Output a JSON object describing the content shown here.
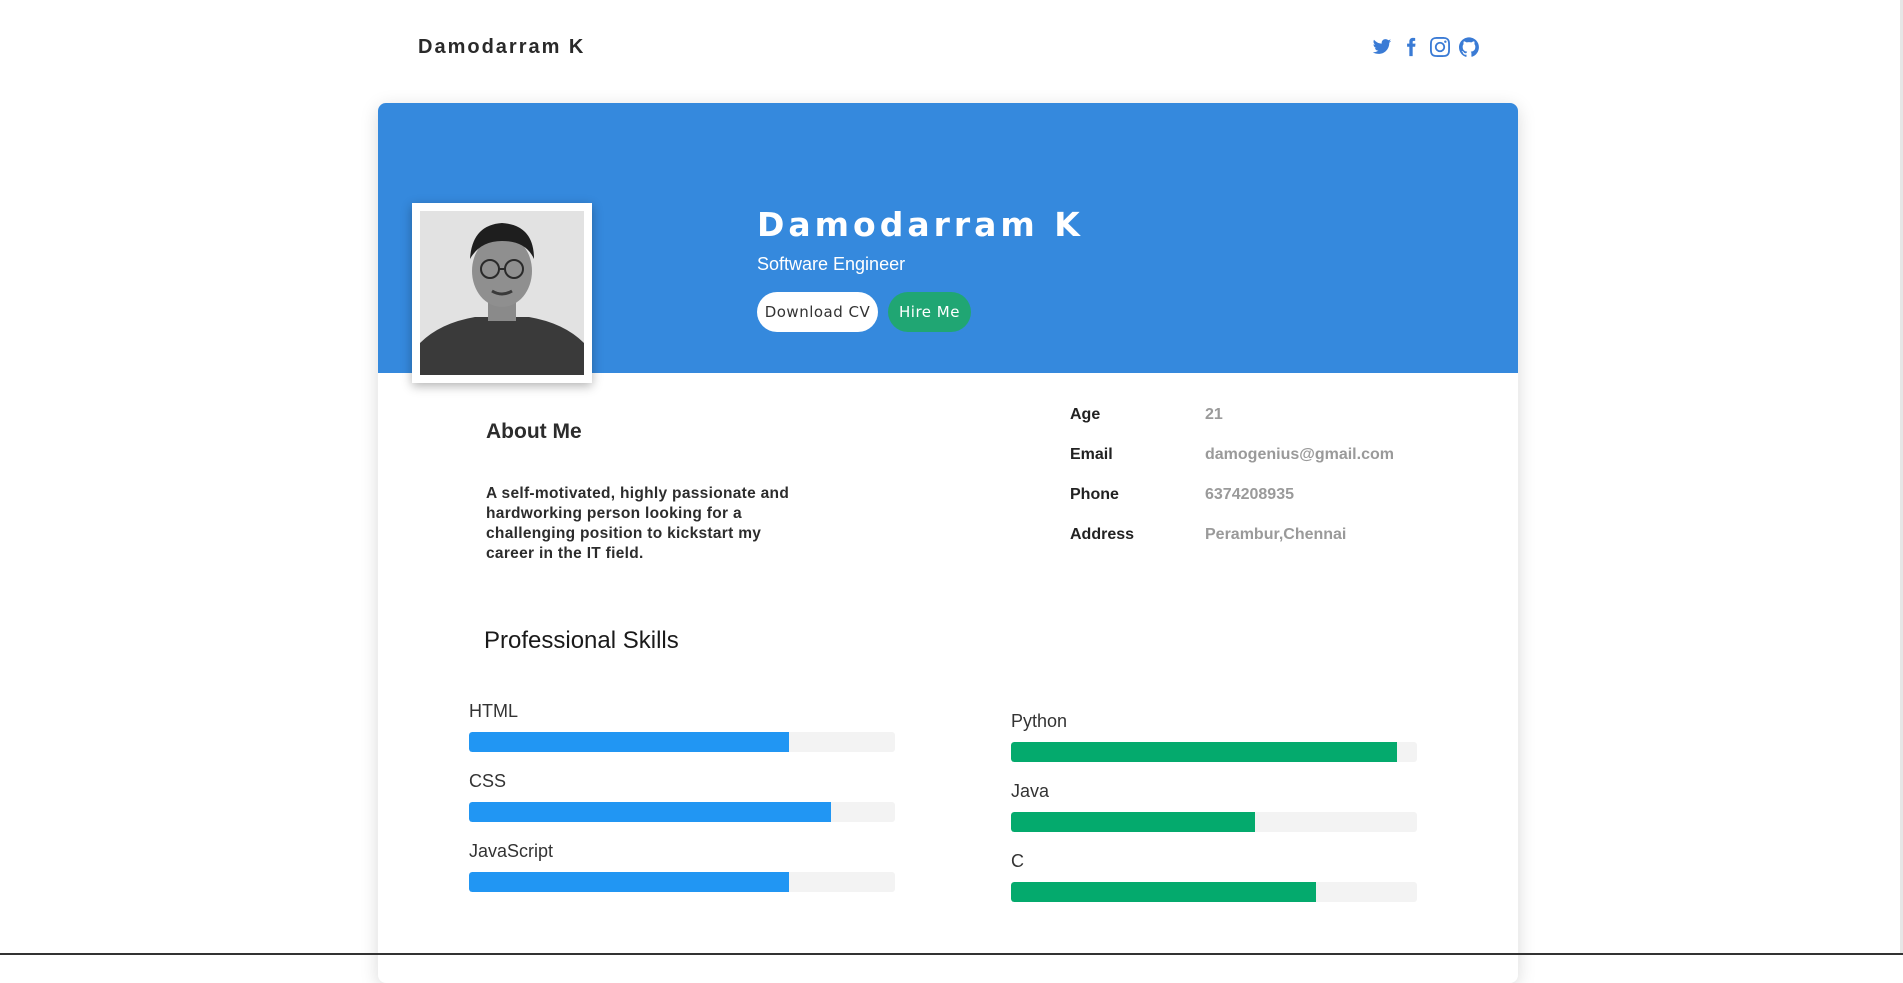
{
  "header": {
    "brand": "Damodarram K",
    "social_icons": [
      "twitter-icon",
      "facebook-icon",
      "instagram-icon",
      "github-icon"
    ]
  },
  "profile": {
    "name": "Damodarram K",
    "title": "Software Engineer",
    "download_cv_label": "Download CV",
    "hire_me_label": "Hire Me"
  },
  "about": {
    "heading": "About Me",
    "text": "A self-motivated, highly passionate and hardworking person looking for a challenging position to kickstart my career in the IT field."
  },
  "info": [
    {
      "key": "Age",
      "value": "21"
    },
    {
      "key": "Email",
      "value": "damogenius@gmail.com"
    },
    {
      "key": "Phone",
      "value": "6374208935"
    },
    {
      "key": "Address",
      "value": "Perambur,Chennai"
    }
  ],
  "skills": {
    "heading": "Professional Skills",
    "left": [
      {
        "name": "HTML",
        "level": 0.75
      },
      {
        "name": "CSS",
        "level": 0.85
      },
      {
        "name": "JavaScript",
        "level": 0.75
      }
    ],
    "right": [
      {
        "name": "Python",
        "level": 0.95
      },
      {
        "name": "Java",
        "level": 0.6
      },
      {
        "name": "C",
        "level": 0.75
      }
    ]
  },
  "colors": {
    "hero": "#3589dd",
    "hire_button": "#20a673",
    "bar_blue": "#2196f3",
    "bar_green": "#04aa6d"
  }
}
